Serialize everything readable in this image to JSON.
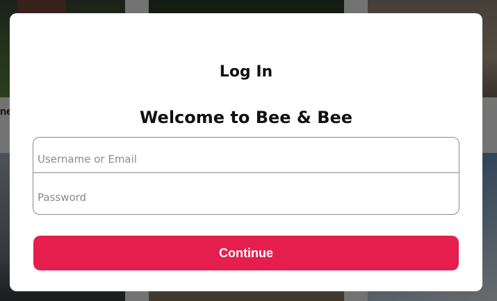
{
  "background": {
    "partial_listing_text": "ne"
  },
  "modal": {
    "title": "Log In",
    "subtitle": "Welcome to Bee & Bee",
    "username_placeholder": "Username or Email",
    "username_value": "",
    "password_placeholder": "Password",
    "password_value": "",
    "continue_label": "Continue"
  },
  "colors": {
    "accent": "#e61e4d",
    "overlay": "rgba(0,0,0,0.55)"
  }
}
